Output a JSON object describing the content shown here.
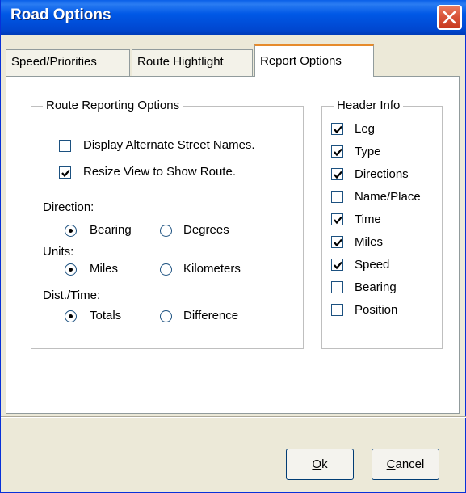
{
  "window": {
    "title": "Road Options"
  },
  "tabs": [
    {
      "label": "Speed/Priorities"
    },
    {
      "label": "Route Hightlight"
    },
    {
      "label": "Report Options"
    }
  ],
  "route_group": {
    "legend": "Route Reporting Options",
    "display_alt_names": {
      "label": "Display Alternate Street Names.",
      "checked": false
    },
    "resize_view": {
      "label": "Resize View to Show Route.",
      "checked": true
    },
    "direction": {
      "label": "Direction:",
      "options": [
        "Bearing",
        "Degrees"
      ],
      "selected": "Bearing"
    },
    "units": {
      "label": "Units:",
      "options": [
        "Miles",
        "Kilometers"
      ],
      "selected": "Miles"
    },
    "dist_time": {
      "label": "Dist./Time:",
      "options": [
        "Totals",
        "Difference"
      ],
      "selected": "Totals"
    }
  },
  "header_group": {
    "legend": "Header Info",
    "items": [
      {
        "label": "Leg",
        "checked": true
      },
      {
        "label": "Type",
        "checked": true
      },
      {
        "label": "Directions",
        "checked": true
      },
      {
        "label": "Name/Place",
        "checked": false
      },
      {
        "label": "Time",
        "checked": true
      },
      {
        "label": "Miles",
        "checked": true
      },
      {
        "label": "Speed",
        "checked": true
      },
      {
        "label": "Bearing",
        "checked": false
      },
      {
        "label": "Position",
        "checked": false
      }
    ]
  },
  "buttons": {
    "ok": {
      "mnemonic": "O",
      "rest": "k"
    },
    "cancel": {
      "mnemonic": "C",
      "rest": "ancel"
    }
  },
  "colors": {
    "titlebar": "#0058e6",
    "tab_highlight": "#e68b2c",
    "close": "#d9553a"
  }
}
